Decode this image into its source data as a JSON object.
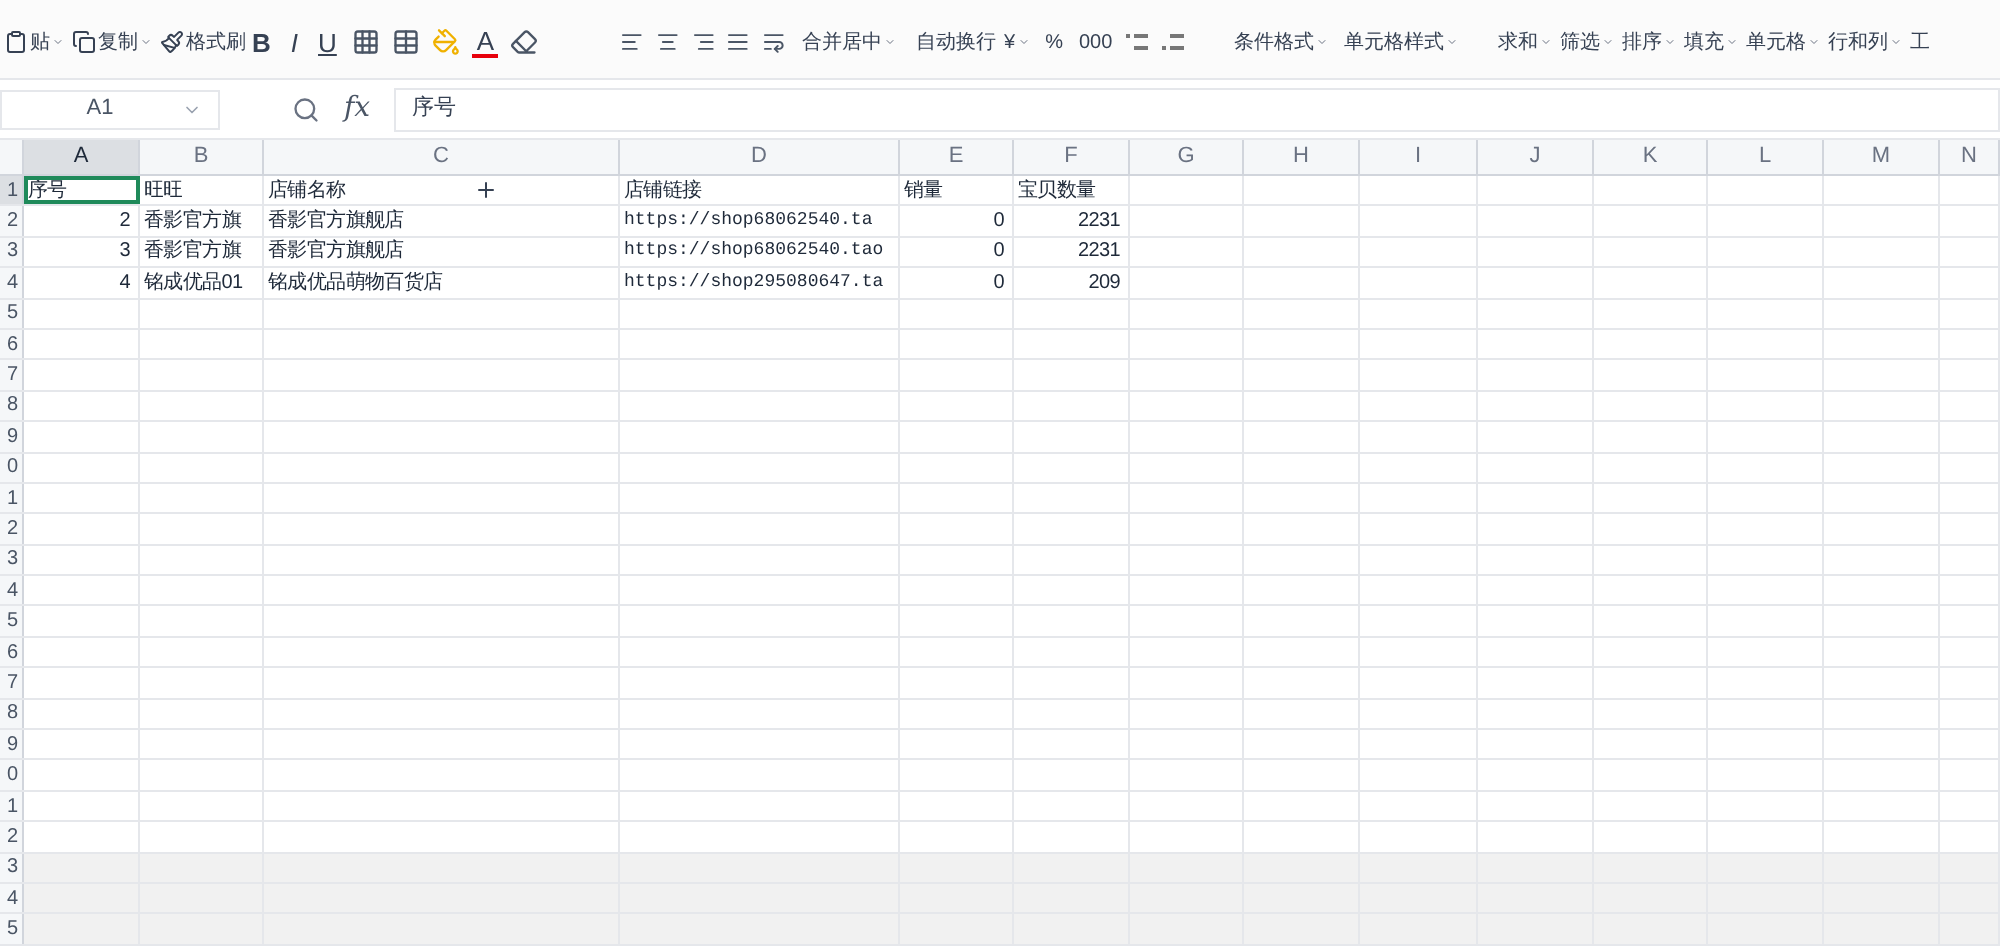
{
  "toolbar": {
    "clipboard": [
      {
        "label": "贴",
        "dropdown": true
      },
      {
        "label": "复制",
        "dropdown": true
      },
      {
        "label": "格式刷",
        "dropdown": false
      }
    ],
    "font": {
      "bold": "B",
      "italic": "I",
      "underline": "U",
      "font_color": "A"
    },
    "alignment": [
      {
        "label": "合并居中",
        "dropdown": true
      },
      {
        "label": "自动换行",
        "dropdown": false
      }
    ],
    "number": [
      {
        "label": "¥",
        "dropdown": true
      },
      {
        "label": "%",
        "dropdown": false
      },
      {
        "label": "000",
        "dropdown": false
      }
    ],
    "styles": [
      {
        "label": "条件格式",
        "dropdown": true
      },
      {
        "label": "单元格样式",
        "dropdown": true
      }
    ],
    "editing": [
      {
        "label": "求和",
        "dropdown": true
      },
      {
        "label": "筛选",
        "dropdown": true
      },
      {
        "label": "排序",
        "dropdown": true
      },
      {
        "label": "填充",
        "dropdown": true
      },
      {
        "label": "单元格",
        "dropdown": true
      },
      {
        "label": "行和列",
        "dropdown": true
      },
      {
        "label": "工",
        "dropdown": false
      }
    ]
  },
  "formula_bar": {
    "name_box": "A1",
    "fx": "fx",
    "value": "序号"
  },
  "columns": [
    {
      "label": "A",
      "selected": true
    },
    {
      "label": "B",
      "selected": false
    },
    {
      "label": "C",
      "selected": false
    },
    {
      "label": "D",
      "selected": false
    },
    {
      "label": "E",
      "selected": false
    },
    {
      "label": "F",
      "selected": false
    },
    {
      "label": "G",
      "selected": false
    },
    {
      "label": "H",
      "selected": false
    },
    {
      "label": "I",
      "selected": false
    },
    {
      "label": "J",
      "selected": false
    },
    {
      "label": "K",
      "selected": false
    },
    {
      "label": "L",
      "selected": false
    },
    {
      "label": "M",
      "selected": false
    },
    {
      "label": "N",
      "selected": false
    }
  ],
  "rows": [
    {
      "number": "1",
      "selected": true,
      "cells": [
        "序号",
        "旺旺",
        "店铺名称",
        "店铺链接",
        "销量",
        "宝贝数量"
      ]
    },
    {
      "number": "2",
      "selected": false,
      "cells": [
        "2",
        "香影官方旗",
        "香影官方旗舰店",
        "https://shop68062540.ta",
        "0",
        "2231"
      ]
    },
    {
      "number": "3",
      "selected": false,
      "cells": [
        "3",
        "香影官方旗",
        "香影官方旗舰店",
        "https://shop68062540.tao",
        "0",
        "2231"
      ]
    },
    {
      "number": "4",
      "selected": false,
      "cells": [
        "4",
        "铭成优品01",
        "铭成优品萌物百货店",
        "https://shop295080647.ta",
        "0",
        "209"
      ]
    },
    {
      "number": "5",
      "selected": false,
      "cells": []
    },
    {
      "number": "6",
      "selected": false,
      "cells": []
    },
    {
      "number": "7",
      "selected": false,
      "cells": []
    },
    {
      "number": "8",
      "selected": false,
      "cells": []
    },
    {
      "number": "9",
      "selected": false,
      "cells": []
    },
    {
      "number": "0",
      "selected": false,
      "cells": []
    },
    {
      "number": "1",
      "selected": false,
      "cells": []
    },
    {
      "number": "2",
      "selected": false,
      "cells": []
    },
    {
      "number": "3",
      "selected": false,
      "cells": []
    },
    {
      "number": "4",
      "selected": false,
      "cells": []
    },
    {
      "number": "5",
      "selected": false,
      "cells": []
    },
    {
      "number": "6",
      "selected": false,
      "cells": []
    },
    {
      "number": "7",
      "selected": false,
      "cells": []
    },
    {
      "number": "8",
      "selected": false,
      "cells": []
    },
    {
      "number": "9",
      "selected": false,
      "cells": []
    },
    {
      "number": "0",
      "selected": false,
      "cells": []
    },
    {
      "number": "1",
      "selected": false,
      "cells": []
    },
    {
      "number": "2",
      "selected": false,
      "cells": []
    },
    {
      "number": "3",
      "selected": false,
      "cells": []
    },
    {
      "number": "4",
      "selected": false,
      "cells": []
    },
    {
      "number": "5",
      "selected": false,
      "cells": []
    }
  ]
}
